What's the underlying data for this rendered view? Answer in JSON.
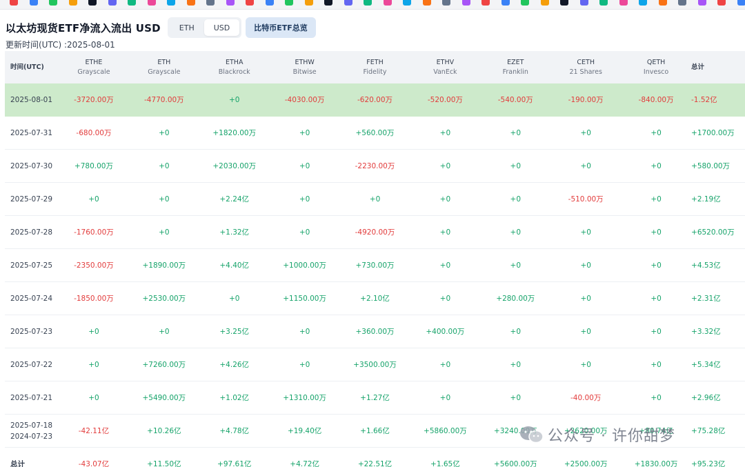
{
  "page": {
    "title": "以太坊现货ETF净流入流出 USD",
    "updated_label": "更新时间(UTC) :2025-08-01"
  },
  "toggle": {
    "eth_label": "ETH",
    "usd_label": "USD",
    "btc_overview_label": "比特币ETF总览"
  },
  "table": {
    "headers": [
      {
        "ticker": "时间(UTC)",
        "issuer": ""
      },
      {
        "ticker": "ETHE",
        "issuer": "Grayscale"
      },
      {
        "ticker": "ETH",
        "issuer": "Grayscale"
      },
      {
        "ticker": "ETHA",
        "issuer": "Blackrock"
      },
      {
        "ticker": "ETHW",
        "issuer": "Bitwise"
      },
      {
        "ticker": "FETH",
        "issuer": "Fidelity"
      },
      {
        "ticker": "ETHV",
        "issuer": "VanEck"
      },
      {
        "ticker": "EZET",
        "issuer": "Franklin"
      },
      {
        "ticker": "CETH",
        "issuer": "21 Shares"
      },
      {
        "ticker": "QETH",
        "issuer": "Invesco"
      },
      {
        "ticker": "总计",
        "issuer": ""
      }
    ],
    "rows": [
      {
        "date": "2025-08-01",
        "values": [
          "-3720.00万",
          "-4770.00万",
          "+0",
          "-4030.00万",
          "-620.00万",
          "-520.00万",
          "-540.00万",
          "-190.00万",
          "-840.00万"
        ],
        "total": "-1.52亿"
      },
      {
        "date": "2025-07-31",
        "values": [
          "-680.00万",
          "+0",
          "+1820.00万",
          "+0",
          "+560.00万",
          "+0",
          "+0",
          "+0",
          "+0"
        ],
        "total": "+1700.00万"
      },
      {
        "date": "2025-07-30",
        "values": [
          "+780.00万",
          "+0",
          "+2030.00万",
          "+0",
          "-2230.00万",
          "+0",
          "+0",
          "+0",
          "+0"
        ],
        "total": "+580.00万"
      },
      {
        "date": "2025-07-29",
        "values": [
          "+0",
          "+0",
          "+2.24亿",
          "+0",
          "+0",
          "+0",
          "+0",
          "-510.00万",
          "+0"
        ],
        "total": "+2.19亿"
      },
      {
        "date": "2025-07-28",
        "values": [
          "-1760.00万",
          "+0",
          "+1.32亿",
          "+0",
          "-4920.00万",
          "+0",
          "+0",
          "+0",
          "+0"
        ],
        "total": "+6520.00万"
      },
      {
        "date": "2025-07-25",
        "values": [
          "-2350.00万",
          "+1890.00万",
          "+4.40亿",
          "+1000.00万",
          "+730.00万",
          "+0",
          "+0",
          "+0",
          "+0"
        ],
        "total": "+4.53亿"
      },
      {
        "date": "2025-07-24",
        "values": [
          "-1850.00万",
          "+2530.00万",
          "+0",
          "+1150.00万",
          "+2.10亿",
          "+0",
          "+280.00万",
          "+0",
          "+0"
        ],
        "total": "+2.31亿"
      },
      {
        "date": "2025-07-23",
        "values": [
          "+0",
          "+0",
          "+3.25亿",
          "+0",
          "+360.00万",
          "+400.00万",
          "+0",
          "+0",
          "+0"
        ],
        "total": "+3.32亿"
      },
      {
        "date": "2025-07-22",
        "values": [
          "+0",
          "+7260.00万",
          "+4.26亿",
          "+0",
          "+3500.00万",
          "+0",
          "+0",
          "+0",
          "+0"
        ],
        "total": "+5.34亿"
      },
      {
        "date": "2025-07-21",
        "values": [
          "+0",
          "+5490.00万",
          "+1.02亿",
          "+1310.00万",
          "+1.27亿",
          "+0",
          "+0",
          "-40.00万",
          "+0"
        ],
        "total": "+2.96亿"
      },
      {
        "date": "2025-07-18",
        "date2": "2024-07-23",
        "values": [
          "-42.11亿",
          "+10.26亿",
          "+4.78亿",
          "+19.40亿",
          "+1.66亿",
          "+5860.00万",
          "+3240.00万",
          "+2620.00万",
          "+80.74亿"
        ],
        "total": "+75.28亿"
      },
      {
        "date": "总计",
        "values": [
          "-43.07亿",
          "+11.50亿",
          "+97.61亿",
          "+4.72亿",
          "+22.51亿",
          "+1.65亿",
          "+5600.00万",
          "+2500.00万",
          "+1830.00万"
        ],
        "total": "+95.23亿"
      }
    ]
  },
  "watermark": {
    "text": "公众号 · 许你甜梦",
    "icon": "wechat-icon"
  },
  "colors": {
    "positive": "#16a36a",
    "negative": "#e23b3b",
    "highlight_row": "#cdeacb",
    "header_bg": "#f1f3f6",
    "active_btn": "#dbe7f6"
  }
}
